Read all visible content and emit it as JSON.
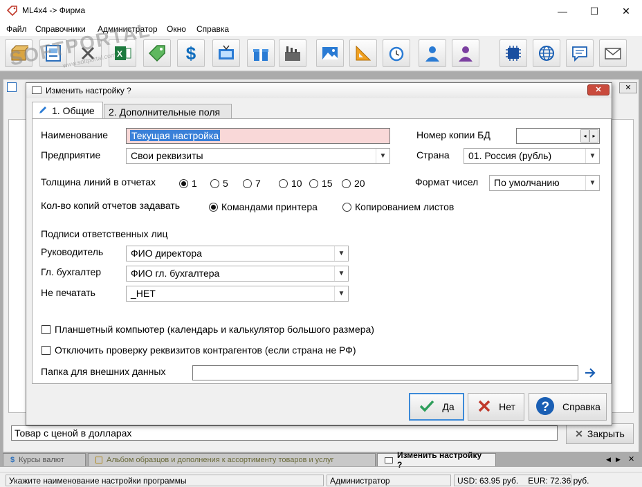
{
  "window": {
    "title": "ML4x4 -> Фирма",
    "minimize": "—",
    "maximize": "☐",
    "close": "✕"
  },
  "menu": [
    "Файл",
    "Справочники",
    "Администратор",
    "Окно",
    "Справка"
  ],
  "toolbar": {
    "icons": [
      "box-icon",
      "picture-list-icon",
      "crossed-icon",
      "excel-icon",
      "tag-icon",
      "dollar-icon",
      "tv-icon",
      "gift-icon",
      "factory-icon",
      "landscape-icon",
      "ruler-icon",
      "alarm-clock-icon",
      "man-icon",
      "woman-icon",
      "chip-icon",
      "globe-icon",
      "chat-icon",
      "mail-icon"
    ],
    "colors": {
      "dollar": "#0f6cbd",
      "accent": "#2a7bd4",
      "woman": "#7b3fa0"
    }
  },
  "watermark": {
    "text": "SOFTPORTAL",
    "subtext": "www.softportal.com"
  },
  "dialog": {
    "title": "Изменить настройку ?",
    "close": "✕",
    "tabs": [
      "1. Общие",
      "2. Дополнительные поля"
    ],
    "name_label": "Наименование",
    "name_value": "Текущая настройка",
    "db_copy_label": "Номер копии БД",
    "db_copy_value": "",
    "company_label": "Предприятие",
    "company_value": "Свои реквизиты",
    "country_label": "Страна",
    "country_value": "01. Россия (рубль)",
    "line_width_label": "Толщина линий в отчетах",
    "line_width_options": [
      "1",
      "5",
      "7",
      "10",
      "15",
      "20"
    ],
    "line_width_selected": "1",
    "number_format_label": "Формат чисел",
    "number_format_value": "По умолчанию",
    "copies_label": "Кол-во копий отчетов задавать",
    "copies_options": [
      "Командами принтера",
      "Копированием листов"
    ],
    "copies_selected": "Командами принтера",
    "signatures_heading": "Подписи ответственных лиц",
    "director_label": "Руководитель",
    "director_value": "ФИО директора",
    "accountant_label": "Гл. бухгалтер",
    "accountant_value": "ФИО гл. бухгалтера",
    "noprint_label": "Не печатать",
    "noprint_value": "_НЕТ",
    "tablet_check": "Планшетный компьютер (календарь и калькулятор большого размера)",
    "verify_check": "Отключить проверку реквизитов контрагентов (если страна не РФ)",
    "folder_label": "Папка для внешних данных",
    "folder_value": "",
    "ok_label": "Да",
    "no_label": "Нет",
    "help_label": "Справка"
  },
  "background": {
    "product_value": "Товар с ценой в долларах",
    "close_label": "Закрыть"
  },
  "mdi_tabs": [
    "Курсы валют",
    "Альбом образцов и дополнения к ассортименту товаров и услуг",
    "Изменить настройку ?"
  ],
  "status": {
    "hint": "Укажите наименование настройки программы",
    "user": "Администратор",
    "usd": "USD: 63.95 руб.",
    "eur": "EUR: 72.36 руб."
  }
}
